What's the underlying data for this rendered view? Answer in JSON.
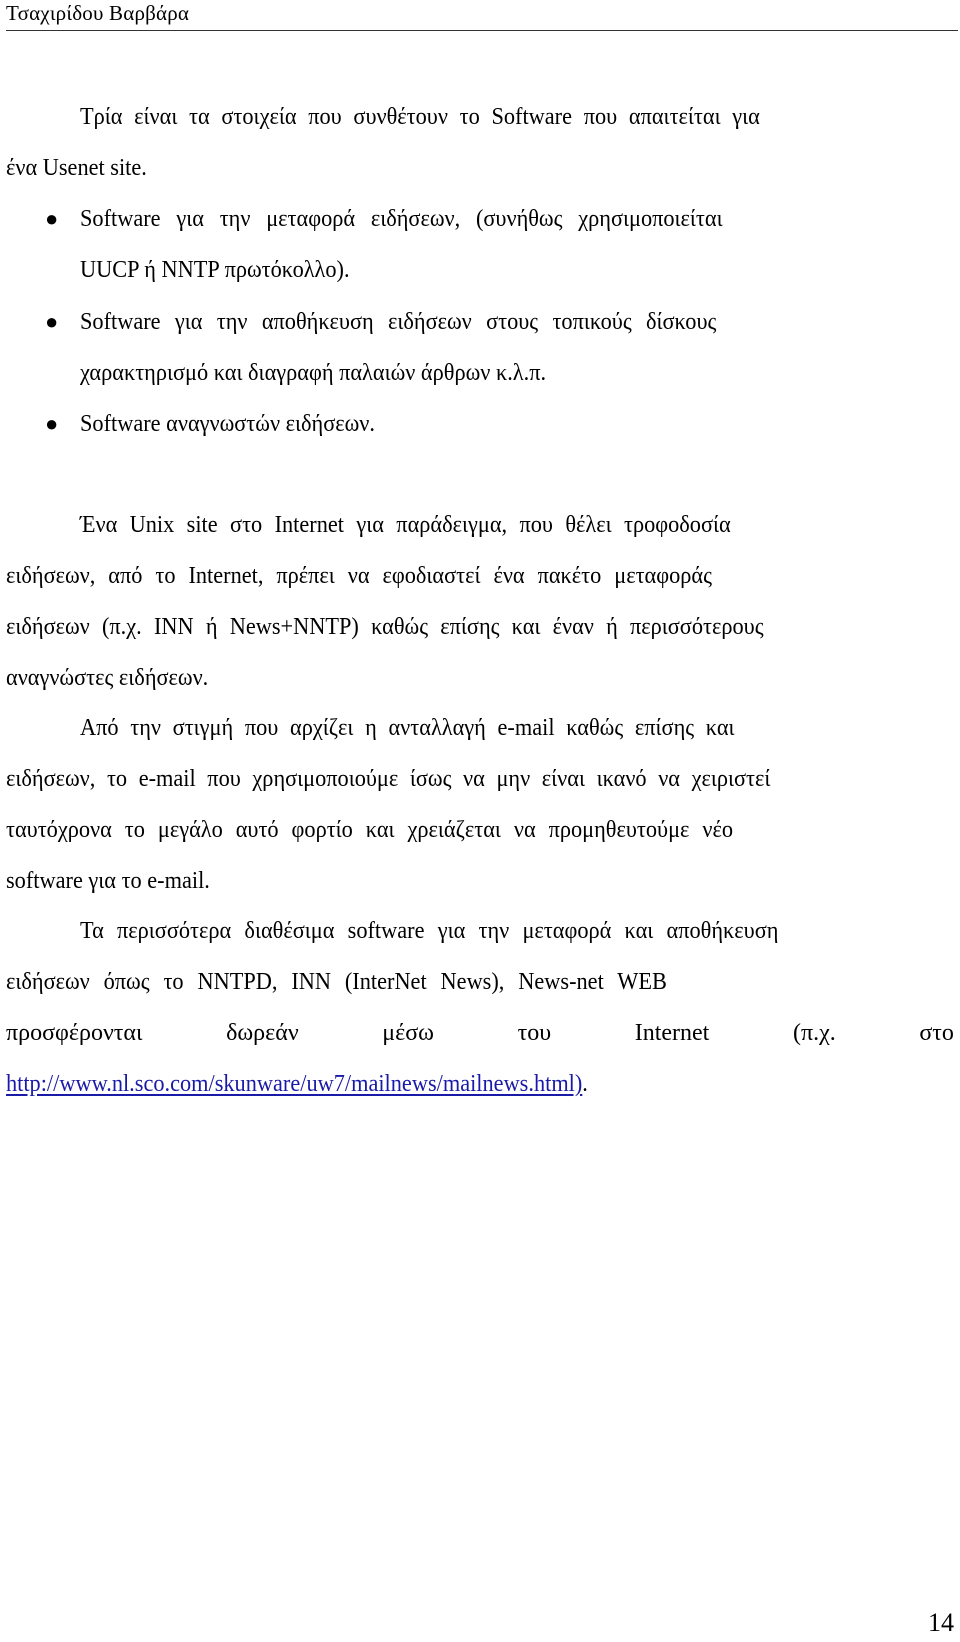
{
  "header": {
    "author": "Τσαχιρίδου Βαρβάρα"
  },
  "intro": {
    "line1": "Τρία είναι τα στοιχεία που συνθέτουν το Software που απαιτείται για",
    "line2": "ένα Usenet site."
  },
  "bullets": [
    {
      "line1": "Software για την μεταφορά ειδήσεων, (συνήθως χρησιμοποιείται",
      "line2": "UUCP ή NNTP πρωτόκολλο)."
    },
    {
      "line1": "Software για την αποθήκευση ειδήσεων στους τοπικούς δίσκους",
      "line2": "χαρακτηρισμό και διαγραφή παλαιών άρθρων κ.λ.π."
    },
    {
      "line1": "Software αναγνωστών ειδήσεων."
    }
  ],
  "paragraph2": {
    "line1": "Ένα Unix site στο Internet για παράδειγμα, που θέλει τροφοδοσία",
    "line2": "ειδήσεων, από το Internet, πρέπει να εφοδιαστεί ένα πακέτο μεταφοράς",
    "line3": "ειδήσεων (π.χ. INN ή News+NNTP) καθώς επίσης και έναν ή περισσότερους",
    "line4": "αναγνώστες ειδήσεων."
  },
  "paragraph3": {
    "line1": "Από την στιγμή που αρχίζει η ανταλλαγή e-mail καθώς επίσης και",
    "line2": "ειδήσεων, το e-mail που χρησιμοποιούμε ίσως να μην είναι ικανό να χειριστεί",
    "line3": "ταυτόχρονα το μεγάλο αυτό φορτίο και χρειάζεται να προμηθευτούμε νέο",
    "line4": "software για το e-mail."
  },
  "paragraph4": {
    "line1": "Τα περισσότερα διαθέσιμα software για την μεταφορά και αποθήκευση",
    "line2": "ειδήσεων όπως το NNTPD, INN (InterNet News), News-net WEB",
    "line3_words": [
      "προσφέρονται",
      "δωρεάν",
      "μέσω",
      "του",
      "Internet",
      "(π.χ.",
      "στο"
    ],
    "link_text": "http://www.nl.sco.com/skunware/uw7/mailnews/mailnews.html)",
    "trailing": "."
  },
  "footer": {
    "page_number": "14"
  },
  "colors": {
    "link": "#1a1aa8",
    "text": "#000000"
  }
}
